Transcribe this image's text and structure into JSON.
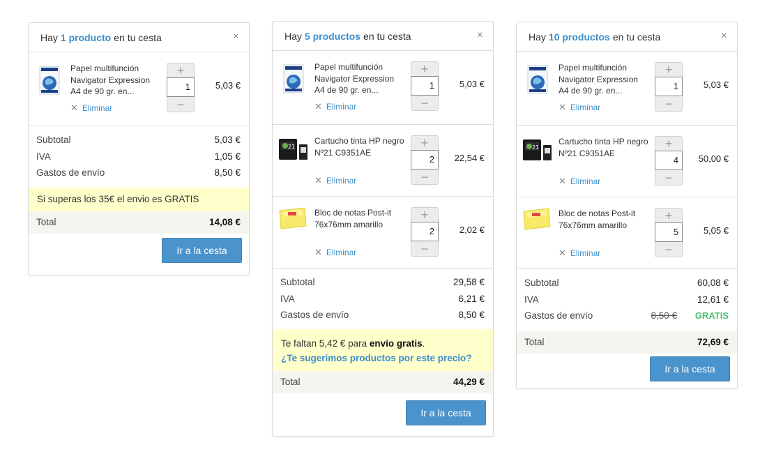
{
  "carts": [
    {
      "header": {
        "prefix": "Hay",
        "count": "1 producto",
        "suffix": "en tu cesta"
      },
      "items": [
        {
          "name": "Papel multifunción Navigator Expression A4 de 90 gr. en...",
          "qty": "1",
          "price": "5,03 €",
          "remove": "Eliminar"
        }
      ],
      "summary": {
        "subtotal_label": "Subtotal",
        "subtotal": "5,03 €",
        "iva_label": "IVA",
        "iva": "1,05 €",
        "shipping_label": "Gastos de envío",
        "shipping": "8,50 €"
      },
      "notice": "Si superas los 35€  el envio es GRATIS",
      "total_label": "Total",
      "total": "14,08 €",
      "button": "Ir a la cesta"
    },
    {
      "header": {
        "prefix": "Hay",
        "count": "5 productos",
        "suffix": "en tu cesta"
      },
      "items": [
        {
          "name": "Papel multifunción Navigator Expression A4 de 90 gr. en...",
          "qty": "1",
          "price": "5,03 €",
          "remove": "Eliminar"
        },
        {
          "name": "Cartucho tinta HP negro Nº21 C9351AE",
          "qty": "2",
          "price": "22,54 €",
          "remove": "Eliminar"
        },
        {
          "name": "Bloc de notas Post-it 76x76mm amarillo",
          "qty": "2",
          "price": "2,02 €",
          "remove": "Eliminar"
        }
      ],
      "summary": {
        "subtotal_label": "Subtotal",
        "subtotal": "29,58 €",
        "iva_label": "IVA",
        "iva": "6,21 €",
        "shipping_label": "Gastos de envío",
        "shipping": "8,50 €"
      },
      "notice": {
        "prefix": "Te faltan 5,42 € para",
        "bold": "envío gratis",
        "suffix": ".",
        "link": "¿Te sugerimos productos por este precio?"
      },
      "total_label": "Total",
      "total": "44,29 €",
      "button": "Ir a la cesta"
    },
    {
      "header": {
        "prefix": "Hay",
        "count": "10 productos",
        "suffix": "en tu cesta"
      },
      "items": [
        {
          "name": "Papel multifunción Navigator Expression A4 de 90 gr. en...",
          "qty": "1",
          "price": "5,03 €",
          "remove": "Eliminar"
        },
        {
          "name": "Cartucho tinta HP negro Nº21 C9351AE",
          "qty": "4",
          "price": "50,00 €",
          "remove": "Eliminar"
        },
        {
          "name": "Bloc de notas Post-it 76x76mm amarillo",
          "qty": "5",
          "price": "5,05 €",
          "remove": "Eliminar"
        }
      ],
      "summary": {
        "subtotal_label": "Subtotal",
        "subtotal": "60,08 €",
        "iva_label": "IVA",
        "iva": "12,61 €",
        "shipping_label": "Gastos de envío",
        "shipping_old": "8,50 €",
        "shipping": "GRATIS"
      },
      "total_label": "Total",
      "total": "72,69 €",
      "button": "Ir a la cesta"
    }
  ],
  "icons": {
    "close": "close-icon",
    "remove": "remove-x-icon",
    "plus": "plus-icon",
    "minus": "minus-icon"
  },
  "colors": {
    "accent": "#3d8ec9",
    "button": "#4b93cc",
    "notice_bg": "#ffffcc",
    "gratis": "#4cc06f"
  }
}
